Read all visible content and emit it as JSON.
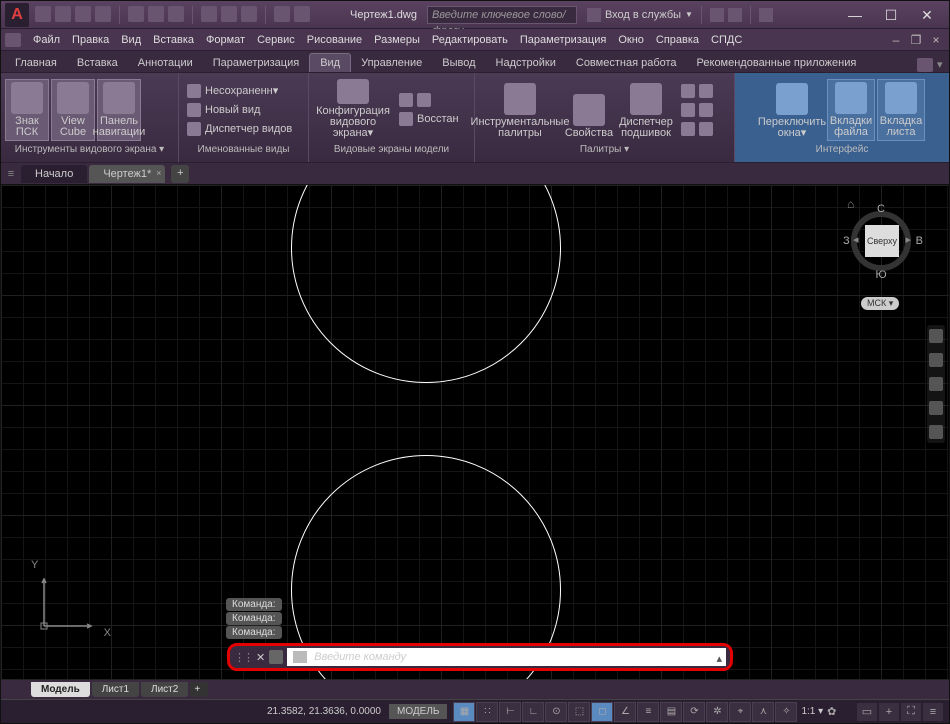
{
  "title_doc": "Чертеж1.dwg",
  "search_placeholder": "Введите ключевое слово/фразу",
  "signin": "Вход в службы",
  "menus": [
    "Файл",
    "Правка",
    "Вид",
    "Вставка",
    "Формат",
    "Сервис",
    "Рисование",
    "Размеры",
    "Редактировать",
    "Параметризация",
    "Окно",
    "Справка",
    "СПДС"
  ],
  "ribbon_tabs": [
    "Главная",
    "Вставка",
    "Аннотации",
    "Параметризация",
    "Вид",
    "Управление",
    "Вывод",
    "Надстройки",
    "Совместная работа",
    "Рекомендованные приложения"
  ],
  "active_ribbon": "Вид",
  "panels": {
    "p1": {
      "title": "Инструменты видового экрана ▾",
      "b1": "Знак ПСК",
      "b2": "View Cube",
      "b3": "Панель навигации"
    },
    "p2": {
      "title": "Именованные виды",
      "r1": "Несохраненн▾",
      "r2": "Новый вид",
      "r3": "Диспетчер видов"
    },
    "p3": {
      "title": "Видовые экраны модели",
      "b1": "Конфигурация видового экрана▾",
      "r1": "",
      "r2": "Восстан"
    },
    "p4": {
      "title": "Палитры ▾",
      "b1": "Инструментальные палитры",
      "b2": "Свойства",
      "b3": "Диспетчер подшивок"
    },
    "p5": {
      "title": "Интерфейс",
      "b1": "Переключить окна▾",
      "b2": "Вкладки файла",
      "b3": "Вкладка листа"
    }
  },
  "doc_tabs": {
    "home": "Начало",
    "active": "Чертеж1*"
  },
  "viewcube": {
    "face": "Сверху",
    "n": "С",
    "s": "Ю",
    "w": "З",
    "e": "В",
    "msk": "МСК ▾"
  },
  "history": [
    "Команда:",
    "Команда:",
    "Команда:"
  ],
  "cmd_placeholder": "Введите команду",
  "layout_tabs": {
    "model": "Модель",
    "l1": "Лист1",
    "l2": "Лист2"
  },
  "status": {
    "coords": "21.3582, 21.3636, 0.0000",
    "mode": "МОДЕЛЬ",
    "scale": "1:1 ▾"
  }
}
